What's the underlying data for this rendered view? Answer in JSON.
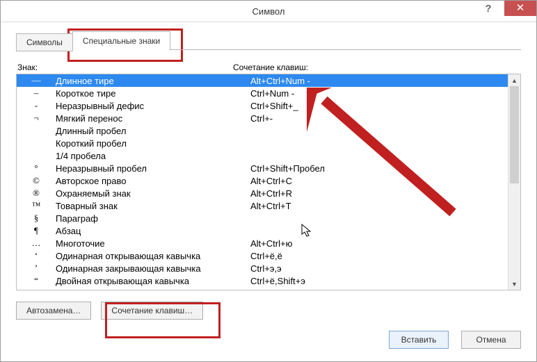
{
  "window": {
    "title": "Символ"
  },
  "tabs": {
    "symbols": "Символы",
    "special": "Специальные знаки"
  },
  "headers": {
    "sign": "Знак:",
    "shortcut": "Сочетание клавиш:"
  },
  "rows": [
    {
      "sym": "—",
      "name": "Длинное тире",
      "key": "Alt+Ctrl+Num -",
      "sel": true
    },
    {
      "sym": "–",
      "name": "Короткое тире",
      "key": "Ctrl+Num -"
    },
    {
      "sym": "-",
      "name": "Неразрывный дефис",
      "key": "Ctrl+Shift+_"
    },
    {
      "sym": "¬",
      "name": "Мягкий перенос",
      "key": "Ctrl+-"
    },
    {
      "sym": "",
      "name": "Длинный пробел",
      "key": ""
    },
    {
      "sym": "",
      "name": "Короткий пробел",
      "key": ""
    },
    {
      "sym": "",
      "name": "1/4 пробела",
      "key": ""
    },
    {
      "sym": "°",
      "name": "Неразрывный пробел",
      "key": "Ctrl+Shift+Пробел"
    },
    {
      "sym": "©",
      "name": "Авторское право",
      "key": "Alt+Ctrl+C"
    },
    {
      "sym": "®",
      "name": "Охраняемый знак",
      "key": "Alt+Ctrl+R"
    },
    {
      "sym": "™",
      "name": "Товарный знак",
      "key": "Alt+Ctrl+T"
    },
    {
      "sym": "§",
      "name": "Параграф",
      "key": ""
    },
    {
      "sym": "¶",
      "name": "Абзац",
      "key": ""
    },
    {
      "sym": "…",
      "name": "Многоточие",
      "key": "Alt+Ctrl+ю"
    },
    {
      "sym": "‘",
      "name": "Одинарная открывающая кавычка",
      "key": "Ctrl+ё,ё"
    },
    {
      "sym": "’",
      "name": "Одинарная закрывающая кавычка",
      "key": "Ctrl+э,э"
    },
    {
      "sym": "“",
      "name": "Двойная открывающая кавычка",
      "key": "Ctrl+ё,Shift+э"
    }
  ],
  "buttons": {
    "autocorrect": "Автозамена…",
    "shortcut": "Сочетание клавиш…",
    "insert": "Вставить",
    "cancel": "Отмена"
  },
  "colors": {
    "accent": "#c02020",
    "select": "#2d89ef"
  }
}
